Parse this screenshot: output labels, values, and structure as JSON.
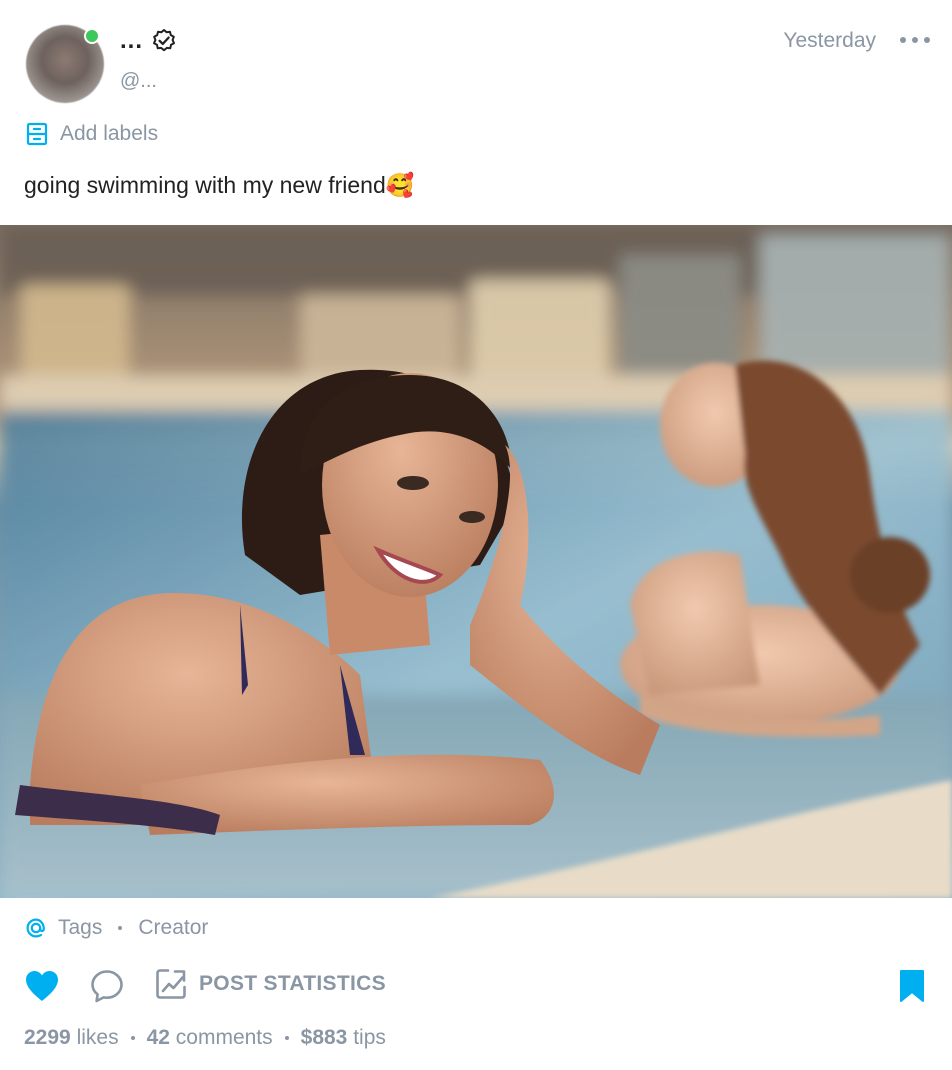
{
  "post": {
    "author_name": "...",
    "author_handle": "@...",
    "time": "Yesterday",
    "labels_label": "Add labels",
    "text": "going swimming with my new friend🥰"
  },
  "footer": {
    "tags_label": "Tags",
    "creator_label": "Creator",
    "stats_label": "POST STATISTICS",
    "likes_count": "2299",
    "likes_label": "likes",
    "comments_count": "42",
    "comments_label": "comments",
    "tips_amount": "$883",
    "tips_label": "tips"
  },
  "icons": {
    "more": "more-horizontal-icon",
    "verified": "verified-badge-icon",
    "labels": "labels-icon",
    "at": "at-sign-icon",
    "like": "heart-icon",
    "comment": "comment-bubble-icon",
    "stats": "stats-chart-icon",
    "bookmark": "bookmark-icon"
  },
  "colors": {
    "accent": "#00aff0",
    "muted": "#8a96a3",
    "online": "#3cc85a",
    "text": "#222222"
  }
}
